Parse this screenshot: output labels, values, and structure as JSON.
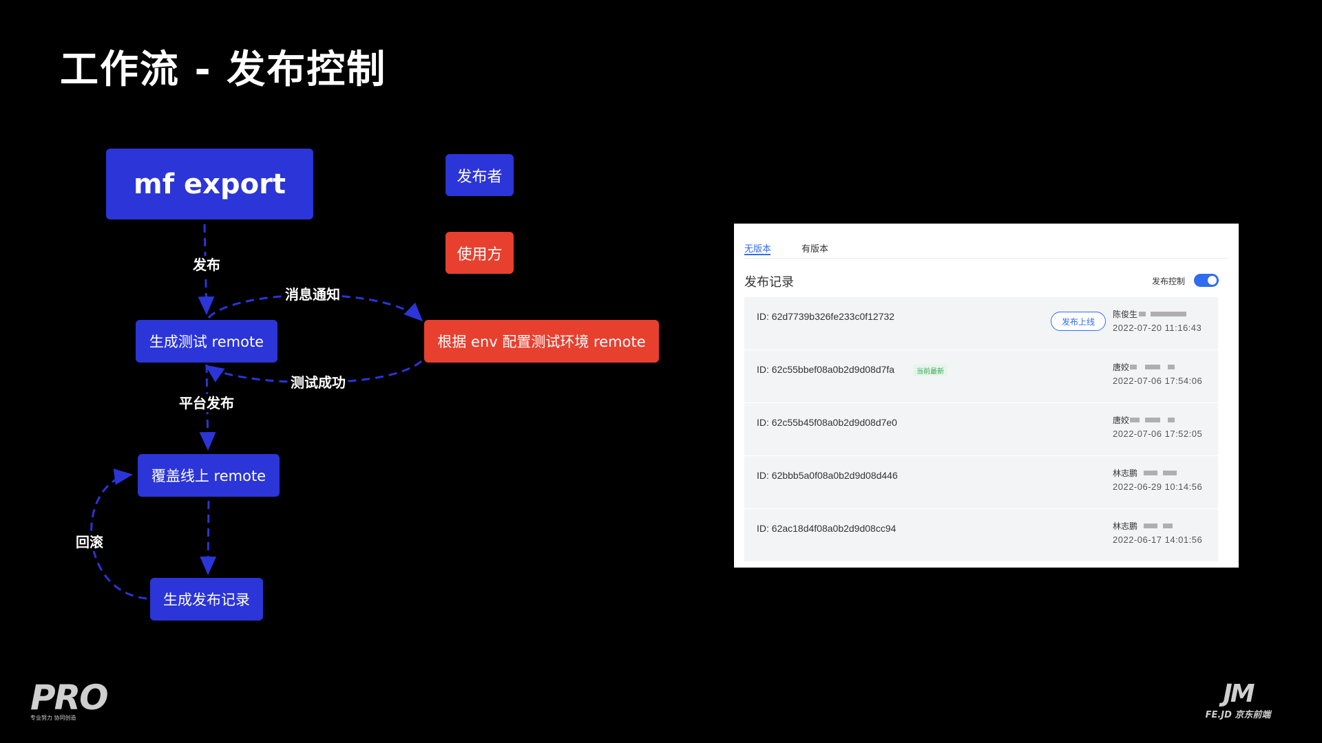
{
  "title": "工作流 - 发布控制",
  "diagram": {
    "nodes": {
      "mf_export": "mf export",
      "publisher": "发布者",
      "consumer": "使用方",
      "gen_test_remote": "生成测试 remote",
      "env_config": "根据 env 配置测试环境 remote",
      "overwrite_online": "覆盖线上 remote",
      "gen_record": "生成发布记录"
    },
    "edges": {
      "publish": "发布",
      "notify": "消息通知",
      "test_success": "测试成功",
      "platform_publish": "平台发布",
      "rollback": "回滚"
    },
    "colors": {
      "publisher": "#2b35d8",
      "consumer": "#e8402f"
    }
  },
  "panel": {
    "tabs": [
      "无版本",
      "有版本"
    ],
    "active_tab": "无版本",
    "section_title": "发布记录",
    "control_label": "发布控制",
    "control_on": true,
    "publish_button": "发布上线",
    "latest_tag": "当前最新",
    "records": [
      {
        "id": "ID: 62d7739b326fe233c0f12732",
        "user": "陈俊生",
        "time": "2022-07-20 11:16:43",
        "action": "发布上线"
      },
      {
        "id": "ID: 62c55bbef08a0b2d9d08d7fa",
        "user": "唐姣",
        "time": "2022-07-06 17:54:06",
        "tag": "当前最新"
      },
      {
        "id": "ID: 62c55b45f08a0b2d9d08d7e0",
        "user": "唐姣",
        "time": "2022-07-06 17:52:05"
      },
      {
        "id": "ID: 62bbb5a0f08a0b2d9d08d446",
        "user": "林志鹏",
        "time": "2022-06-29 10:14:56"
      },
      {
        "id": "ID: 62ac18d4f08a0b2d9d08cc94",
        "user": "林志鹏",
        "time": "2022-06-17 14:01:56"
      }
    ]
  },
  "logos": {
    "pro": "PRO",
    "pro_sub": "专业努力 协同创造",
    "fe_mark": "JM",
    "fe_sub": "FE.JD 京东前端"
  }
}
